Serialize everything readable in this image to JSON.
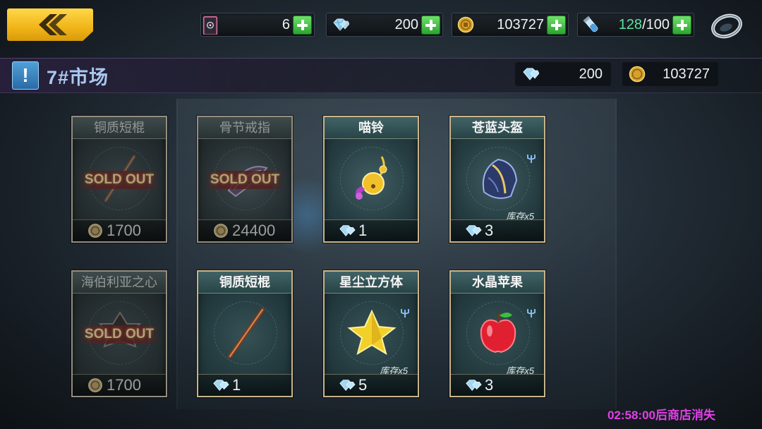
{
  "header": {
    "ticket": {
      "icon": "ticket-icon",
      "value": "6"
    },
    "diamond": {
      "icon": "diamond-icon",
      "value": "200"
    },
    "gold": {
      "icon": "gold-coin-icon",
      "value": "103727"
    },
    "stamina": {
      "icon": "stamina-vial-icon",
      "current": "128",
      "max": "/100"
    }
  },
  "market": {
    "title": "7#市场",
    "diamond_value": "200",
    "gold_value": "103727"
  },
  "items": [
    {
      "name": "铜质短棍",
      "sold_out": true,
      "sold_label": "SOLD OUT",
      "currency": "gold",
      "price": "1700",
      "stock": ""
    },
    {
      "name": "骨节戒指",
      "sold_out": true,
      "sold_label": "SOLD OUT",
      "currency": "gold",
      "price": "24400",
      "stock": ""
    },
    {
      "name": "喵铃",
      "sold_out": false,
      "currency": "diamond",
      "price": "1",
      "stock": ""
    },
    {
      "name": "苍蓝头盔",
      "sold_out": false,
      "currency": "diamond",
      "price": "3",
      "stock": "库存x5"
    },
    {
      "name": "海伯利亚之心",
      "sold_out": true,
      "sold_label": "SOLD OUT",
      "currency": "gold",
      "price": "1700",
      "stock": ""
    },
    {
      "name": "铜质短棍",
      "sold_out": false,
      "currency": "diamond",
      "price": "1",
      "stock": ""
    },
    {
      "name": "星尘立方体",
      "sold_out": false,
      "currency": "diamond",
      "price": "5",
      "stock": "库存x5"
    },
    {
      "name": "水晶苹果",
      "sold_out": false,
      "currency": "diamond",
      "price": "3",
      "stock": "库存x5"
    }
  ],
  "footer": {
    "countdown": "02:58:00后商店消失"
  },
  "colors": {
    "accent_gold": "#f0b418",
    "plus_green": "#2aa52e",
    "title_blue": "#a9c8f0",
    "countdown_magenta": "#e040e6",
    "stamina_green": "#5fe0a0"
  }
}
